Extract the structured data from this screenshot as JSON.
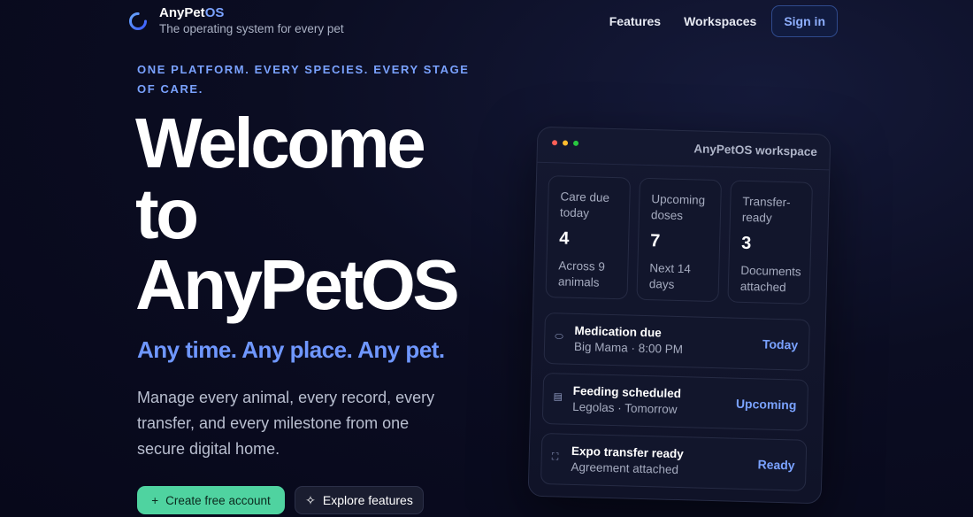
{
  "brand": {
    "name_main": "AnyPet",
    "name_accent": "OS",
    "tagline": "The operating system for every pet",
    "logo_icon": "ring-logo-icon"
  },
  "nav": {
    "features": "Features",
    "workspaces": "Workspaces",
    "signin": "Sign in"
  },
  "hero": {
    "eyebrow": "ONE PLATFORM. EVERY SPECIES. EVERY STAGE OF CARE.",
    "title_line1": "Welcome",
    "title_line2": "to",
    "title_line3": "AnyPetOS",
    "subtitle": "Any time. Any place. Any pet.",
    "description": "Manage every animal, every record, every transfer, and every milestone from one secure digital home.",
    "cta_primary": "Create free account",
    "cta_primary_icon": "+",
    "cta_secondary": "Explore features",
    "cta_secondary_icon": "✧"
  },
  "workspace": {
    "title": "AnyPetOS workspace",
    "window_dots": [
      "#ff5f57",
      "#febc2e",
      "#28c840"
    ],
    "stats": [
      {
        "label": "Care due today",
        "value": "4",
        "sub": "Across 9 animals"
      },
      {
        "label": "Upcoming doses",
        "value": "7",
        "sub": "Next 14 days"
      },
      {
        "label": "Transfer-ready",
        "value": "3",
        "sub": "Documents attached"
      }
    ],
    "tasks": [
      {
        "icon": "pill-icon",
        "glyph": "⬭",
        "title": "Medication due",
        "sub": "Big Mama · 8:00 PM",
        "status": "Today"
      },
      {
        "icon": "calendar-icon",
        "glyph": "▤",
        "title": "Feeding scheduled",
        "sub": "Legolas · Tomorrow",
        "status": "Upcoming"
      },
      {
        "icon": "scan-icon",
        "glyph": "⛶",
        "title": "Expo transfer ready",
        "sub": "Agreement attached",
        "status": "Ready"
      }
    ]
  },
  "colors": {
    "accent": "#7aa2ff",
    "cta_green": "#4fd3a0",
    "background": "#07081a"
  }
}
